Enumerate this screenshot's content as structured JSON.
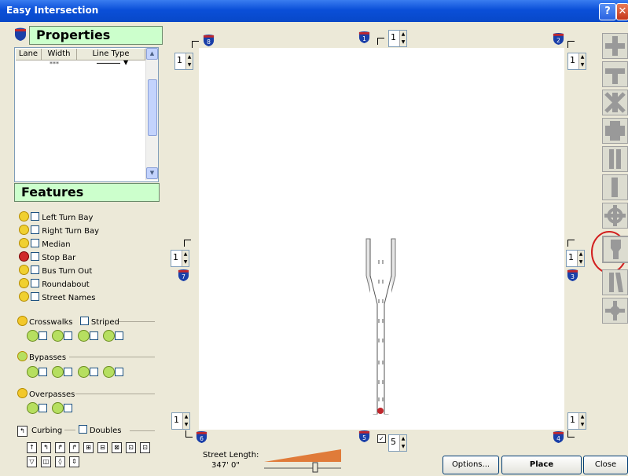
{
  "window": {
    "title": "Easy Intersection",
    "help_label": "?",
    "close_label": "✕"
  },
  "properties": {
    "header": "Properties",
    "columns": [
      "Lane",
      "Width",
      "Line Type"
    ],
    "row": {
      "width_value": "***"
    }
  },
  "features": {
    "header": "Features",
    "items": [
      "Left Turn Bay",
      "Right Turn Bay",
      "Median",
      "Stop Bar",
      "Bus Turn Out",
      "Roundabout",
      "Street Names"
    ],
    "crosswalks_label": "Crosswalks",
    "striped_label": "Striped",
    "bypasses_label": "Bypasses",
    "overpasses_label": "Overpasses",
    "curbing_label": "Curbing",
    "doubles_label": "Doubles"
  },
  "legs": {
    "l8": "8",
    "l1": "1",
    "l2": "2",
    "l7": "7",
    "l3": "3",
    "l6": "6",
    "l5": "5",
    "l4": "4"
  },
  "spinners": {
    "top_center": "1",
    "top_left": "1",
    "top_right": "1",
    "mid_left": "1",
    "mid_right": "1",
    "bottom_left": "1",
    "bottom_center": "5",
    "bottom_right": "1"
  },
  "street_length": {
    "label": "Street Length:",
    "value": "347' 0\""
  },
  "buttons": {
    "options": "Options...",
    "place": "Place",
    "close": "Close"
  },
  "colors": {
    "accent_green": "#ccffcc",
    "shield_blue": "#1a3fa8",
    "shield_red": "#c0272d",
    "selection_circle": "#d21f1f"
  }
}
